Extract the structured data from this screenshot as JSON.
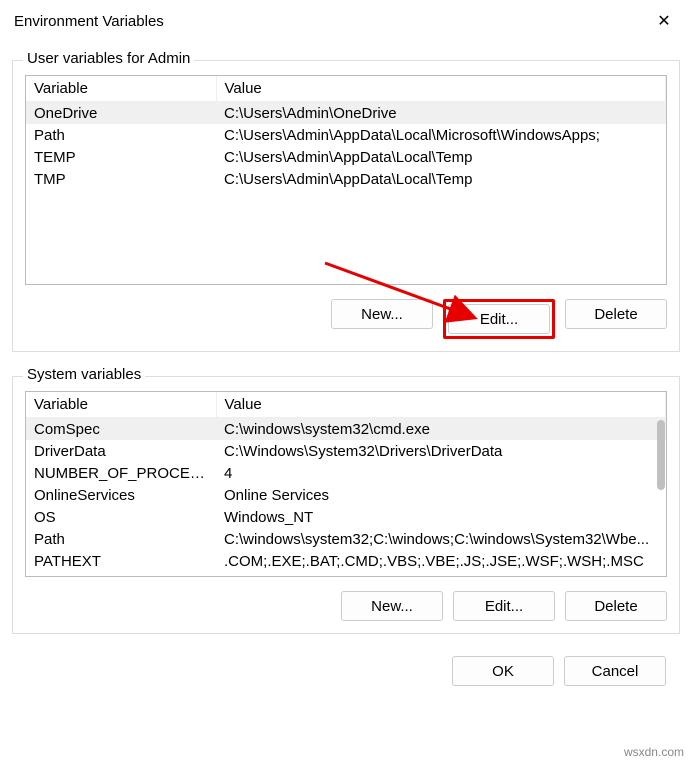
{
  "title": "Environment Variables",
  "close_glyph": "✕",
  "user_section": {
    "label": "User variables for Admin",
    "headers": {
      "var": "Variable",
      "val": "Value"
    },
    "rows": [
      {
        "var": "OneDrive",
        "val": "C:\\Users\\Admin\\OneDrive",
        "selected": true
      },
      {
        "var": "Path",
        "val": "C:\\Users\\Admin\\AppData\\Local\\Microsoft\\WindowsApps;"
      },
      {
        "var": "TEMP",
        "val": "C:\\Users\\Admin\\AppData\\Local\\Temp"
      },
      {
        "var": "TMP",
        "val": "C:\\Users\\Admin\\AppData\\Local\\Temp"
      }
    ],
    "buttons": {
      "new": "New...",
      "edit": "Edit...",
      "delete": "Delete"
    }
  },
  "system_section": {
    "label": "System variables",
    "headers": {
      "var": "Variable",
      "val": "Value"
    },
    "rows": [
      {
        "var": "ComSpec",
        "val": "C:\\windows\\system32\\cmd.exe",
        "selected": true
      },
      {
        "var": "DriverData",
        "val": "C:\\Windows\\System32\\Drivers\\DriverData"
      },
      {
        "var": "NUMBER_OF_PROCESSORS",
        "val": "4"
      },
      {
        "var": "OnlineServices",
        "val": "Online Services"
      },
      {
        "var": "OS",
        "val": "Windows_NT"
      },
      {
        "var": "Path",
        "val": "C:\\windows\\system32;C:\\windows;C:\\windows\\System32\\Wbe..."
      },
      {
        "var": "PATHEXT",
        "val": ".COM;.EXE;.BAT;.CMD;.VBS;.VBE;.JS;.JSE;.WSF;.WSH;.MSC"
      }
    ],
    "buttons": {
      "new": "New...",
      "edit": "Edit...",
      "delete": "Delete"
    }
  },
  "footer": {
    "ok": "OK",
    "cancel": "Cancel"
  },
  "watermark": "wsxdn.com",
  "annotation": {
    "highlight_target": "user-edit-button",
    "arrow_color": "#e60000"
  }
}
